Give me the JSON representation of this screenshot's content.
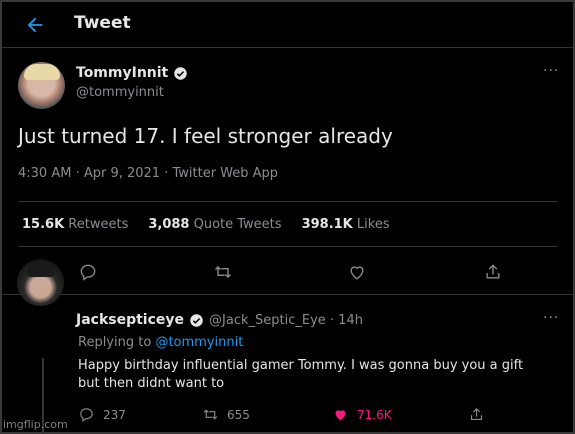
{
  "header": {
    "title": "Tweet",
    "back_icon": "arrow-left-icon",
    "accent": "#1d9bf0"
  },
  "tweet": {
    "author_name": "TommyInnit",
    "author_handle": "@tommyinnit",
    "verified": true,
    "text": "Just turned 17. I feel stronger already",
    "meta": "4:30 AM · Apr 9, 2021 · Twitter Web App",
    "stats": [
      {
        "value": "15.6K",
        "label": "Retweets"
      },
      {
        "value": "3,088",
        "label": "Quote Tweets"
      },
      {
        "value": "398.1K",
        "label": "Likes"
      }
    ],
    "more": "···"
  },
  "reply": {
    "author_name": "Jacksepticeye",
    "author_handle_time": "@Jack_Septic_Eye · 14h",
    "verified": true,
    "replying_to_prefix": "Replying to ",
    "replying_to": "@tommyinnit",
    "text": "Happy birthday influential gamer Tommy. I was gonna buy you a gift but then didnt want to",
    "more": "···",
    "actions": {
      "replies": "237",
      "retweets": "655",
      "likes": "71.6K"
    },
    "like_color": "#f91880"
  },
  "watermark": "imgflip.com"
}
